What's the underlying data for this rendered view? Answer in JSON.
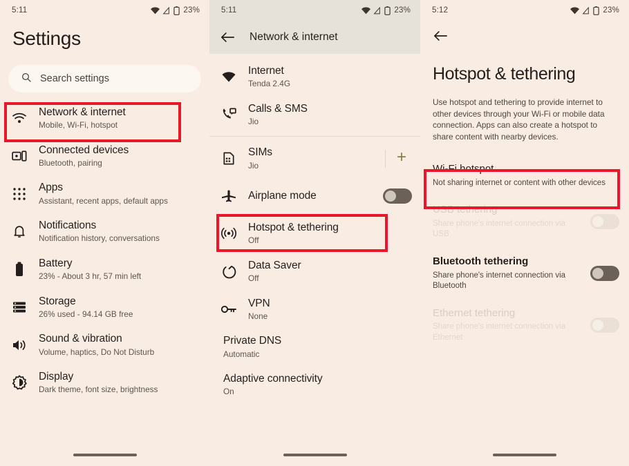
{
  "panels": {
    "settings": {
      "status": {
        "time": "5:11",
        "battery": "23%"
      },
      "title": "Settings",
      "search": {
        "placeholder": "Search settings",
        "icon": "search-icon"
      },
      "items": [
        {
          "icon": "wifi-icon",
          "title": "Network & internet",
          "subtitle": "Mobile, Wi-Fi, hotspot"
        },
        {
          "icon": "connected-devices-icon",
          "title": "Connected devices",
          "subtitle": "Bluetooth, pairing"
        },
        {
          "icon": "apps-grid-icon",
          "title": "Apps",
          "subtitle": "Assistant, recent apps, default apps"
        },
        {
          "icon": "bell-icon",
          "title": "Notifications",
          "subtitle": "Notification history, conversations"
        },
        {
          "icon": "battery-icon",
          "title": "Battery",
          "subtitle": "23% - About 3 hr, 57 min left"
        },
        {
          "icon": "storage-icon",
          "title": "Storage",
          "subtitle": "26% used - 94.14 GB free"
        },
        {
          "icon": "volume-icon",
          "title": "Sound & vibration",
          "subtitle": "Volume, haptics, Do Not Disturb"
        },
        {
          "icon": "brightness-icon",
          "title": "Display",
          "subtitle": "Dark theme, font size, brightness"
        }
      ]
    },
    "network": {
      "status": {
        "time": "5:11",
        "battery": "23%"
      },
      "appbar": {
        "back": "back-arrow-icon",
        "title": "Network & internet"
      },
      "items": [
        {
          "icon": "wifi-filled-icon",
          "title": "Internet",
          "subtitle": "Tenda 2.4G",
          "trail": "none"
        },
        {
          "icon": "calls-sms-icon",
          "title": "Calls & SMS",
          "subtitle": "Jio",
          "trail": "none"
        },
        {
          "icon": "sim-card-icon",
          "title": "SIMs",
          "subtitle": "Jio",
          "trail": "add"
        },
        {
          "icon": "airplane-icon",
          "title": "Airplane mode",
          "subtitle": "",
          "trail": "toggle-off"
        },
        {
          "icon": "hotspot-icon",
          "title": "Hotspot & tethering",
          "subtitle": "Off",
          "trail": "none"
        },
        {
          "icon": "data-saver-icon",
          "title": "Data Saver",
          "subtitle": "Off",
          "trail": "none"
        },
        {
          "icon": "vpn-key-icon",
          "title": "VPN",
          "subtitle": "None",
          "trail": "none"
        },
        {
          "icon": "none",
          "title": "Private DNS",
          "subtitle": "Automatic",
          "trail": "none"
        },
        {
          "icon": "none",
          "title": "Adaptive connectivity",
          "subtitle": "On",
          "trail": "none"
        }
      ],
      "add_label": "+"
    },
    "hotspot": {
      "status": {
        "time": "5:12",
        "battery": "23%"
      },
      "back": "back-arrow-icon",
      "title": "Hotspot & tethering",
      "description": "Use hotspot and tethering to provide internet to other devices through your Wi-Fi or mobile data connection. Apps can also create a hotspot to share content with nearby devices.",
      "items": [
        {
          "title": "Wi-Fi hotspot",
          "subtitle": "Not sharing internet or content with other devices",
          "state": "enabled",
          "toggle": "none"
        },
        {
          "title": "USB tethering",
          "subtitle": "Share phone's internet connection via USB",
          "state": "disabled",
          "toggle": "off-disabled"
        },
        {
          "title": "Bluetooth tethering",
          "subtitle": "Share phone's internet connection via Bluetooth",
          "state": "enabled",
          "toggle": "off-dark"
        },
        {
          "title": "Ethernet tethering",
          "subtitle": "Share phone's internet connection via Ethernet",
          "state": "disabled",
          "toggle": "off-disabled"
        }
      ]
    }
  },
  "highlights": {
    "network_internet": "Network & internet",
    "hotspot_tethering": "Hotspot & tethering",
    "wifi_hotspot": "Wi-Fi hotspot"
  },
  "colors": {
    "background": "#f8ece3",
    "appbar": "#e6e1d9",
    "highlight": "#e8172a",
    "accent_plus": "#8b7b3c",
    "text_primary": "#241f1c",
    "text_secondary": "#5d554e"
  }
}
